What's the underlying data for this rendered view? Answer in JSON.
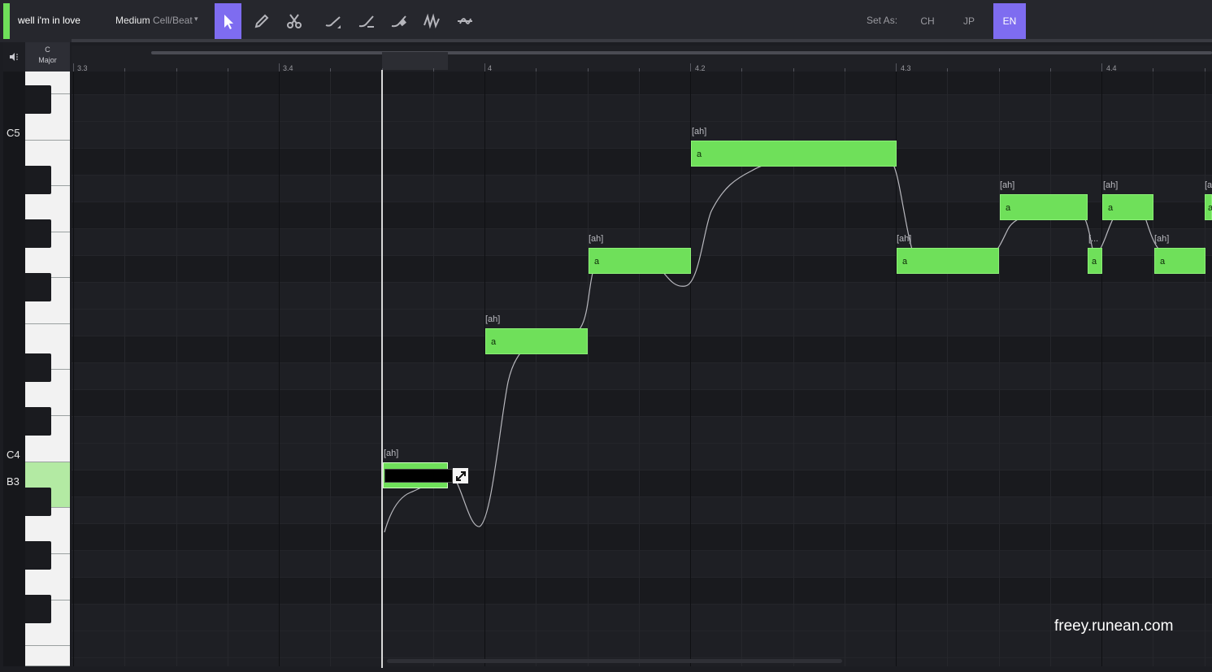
{
  "track": {
    "name": "well i'm in love",
    "accent_color": "#6fe05a"
  },
  "quantize": {
    "label": "Medium",
    "value": "Cell/Beat",
    "caret": "▾"
  },
  "tools": [
    {
      "name": "select-tool-icon",
      "active": true
    },
    {
      "name": "pencil-tool-icon",
      "active": false
    },
    {
      "name": "scissors-tool-icon",
      "active": false
    },
    {
      "name": "pitch-draw-tool-icon",
      "active": false
    },
    {
      "name": "pitch-line-tool-icon",
      "active": false
    },
    {
      "name": "pitch-erase-tool-icon",
      "active": false
    },
    {
      "name": "vibrato-tool-icon",
      "active": false
    },
    {
      "name": "smooth-tool-icon",
      "active": false
    }
  ],
  "set_as": {
    "label": "Set As:",
    "languages": [
      "CH",
      "JP",
      "EN"
    ],
    "selected": "EN"
  },
  "key": {
    "root": "C",
    "mode": "Major"
  },
  "ruler": {
    "labels": [
      "3.3",
      "3.4",
      "4",
      "4.2",
      "4.3",
      "4.4"
    ]
  },
  "piano": {
    "labels": [
      "C5",
      "C4",
      "B3"
    ],
    "highlighted_key": "B3"
  },
  "notes": [
    {
      "phoneme": "[ah]",
      "lyric": "a"
    },
    {
      "phoneme": "[ah]",
      "lyric": "a"
    },
    {
      "phoneme": "[ah]",
      "lyric": "a"
    },
    {
      "phoneme": "[ah]",
      "lyric": "a"
    },
    {
      "phoneme": "[ah]",
      "lyric": "a"
    },
    {
      "phoneme": "[ah]",
      "lyric": "a"
    },
    {
      "phoneme": "[...",
      "lyric": "a"
    },
    {
      "phoneme": "[ah]",
      "lyric": "a"
    },
    {
      "phoneme": "[ah]",
      "lyric": "a"
    },
    {
      "phoneme": "[a",
      "lyric": "a"
    }
  ],
  "editing_note": {
    "phoneme": "[ah]",
    "input_value": ""
  },
  "colors": {
    "accent": "#7e6cf0",
    "note": "#6fe05a",
    "background": "#1c1d22"
  },
  "watermark": "freey.runean.com"
}
